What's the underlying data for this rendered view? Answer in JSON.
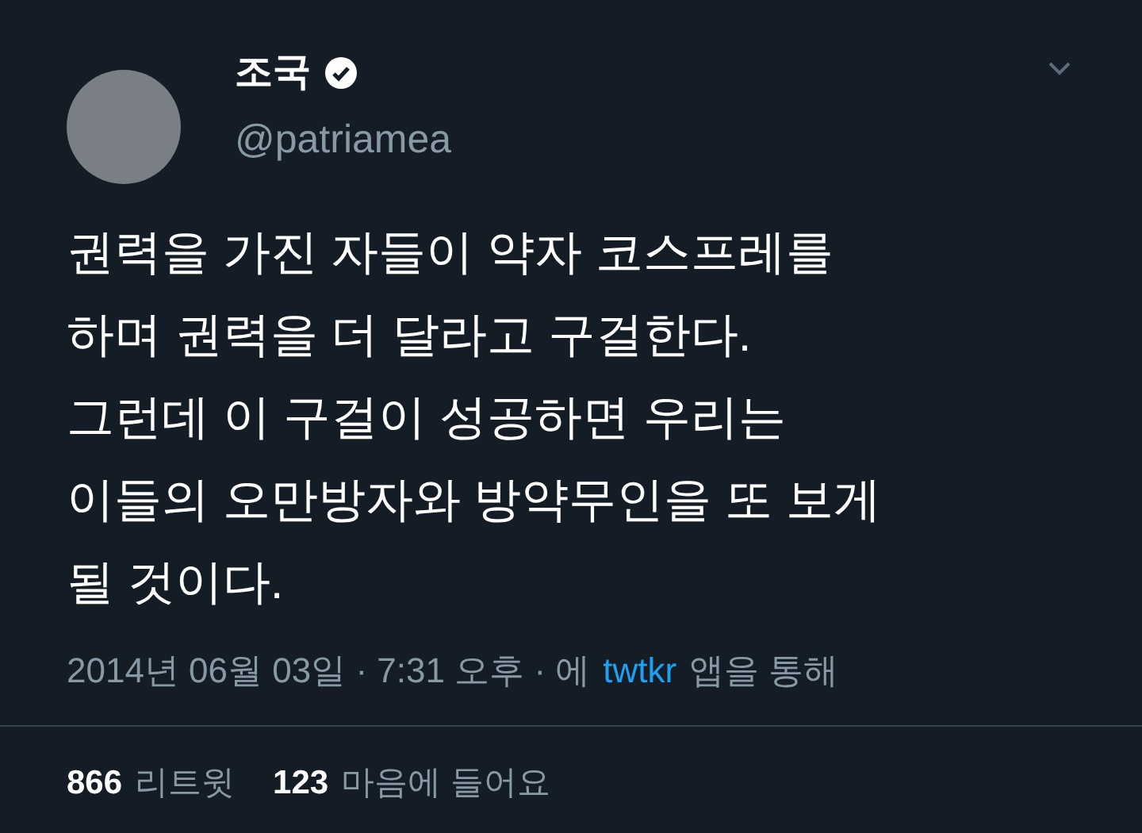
{
  "author": {
    "name": "조국",
    "verified": true,
    "handle": "@patriamea"
  },
  "tweet_lines": [
    "권력을 가진 자들이 약자 코스프레를",
    "하며 권력을 더 달라고 구걸한다.",
    "그런데 이 구걸이 성공하면 우리는",
    "이들의 오만방자와 방약무인을 또 보게",
    "될 것이다."
  ],
  "timestamp": {
    "date": "2014년 06월 03일 · 7:31 오후 · 에",
    "source": "twtkr",
    "suffix": "앱을 통해"
  },
  "stats": [
    {
      "count": "866",
      "label": "리트윗"
    },
    {
      "count": "123",
      "label": "마음에 들어요"
    }
  ]
}
